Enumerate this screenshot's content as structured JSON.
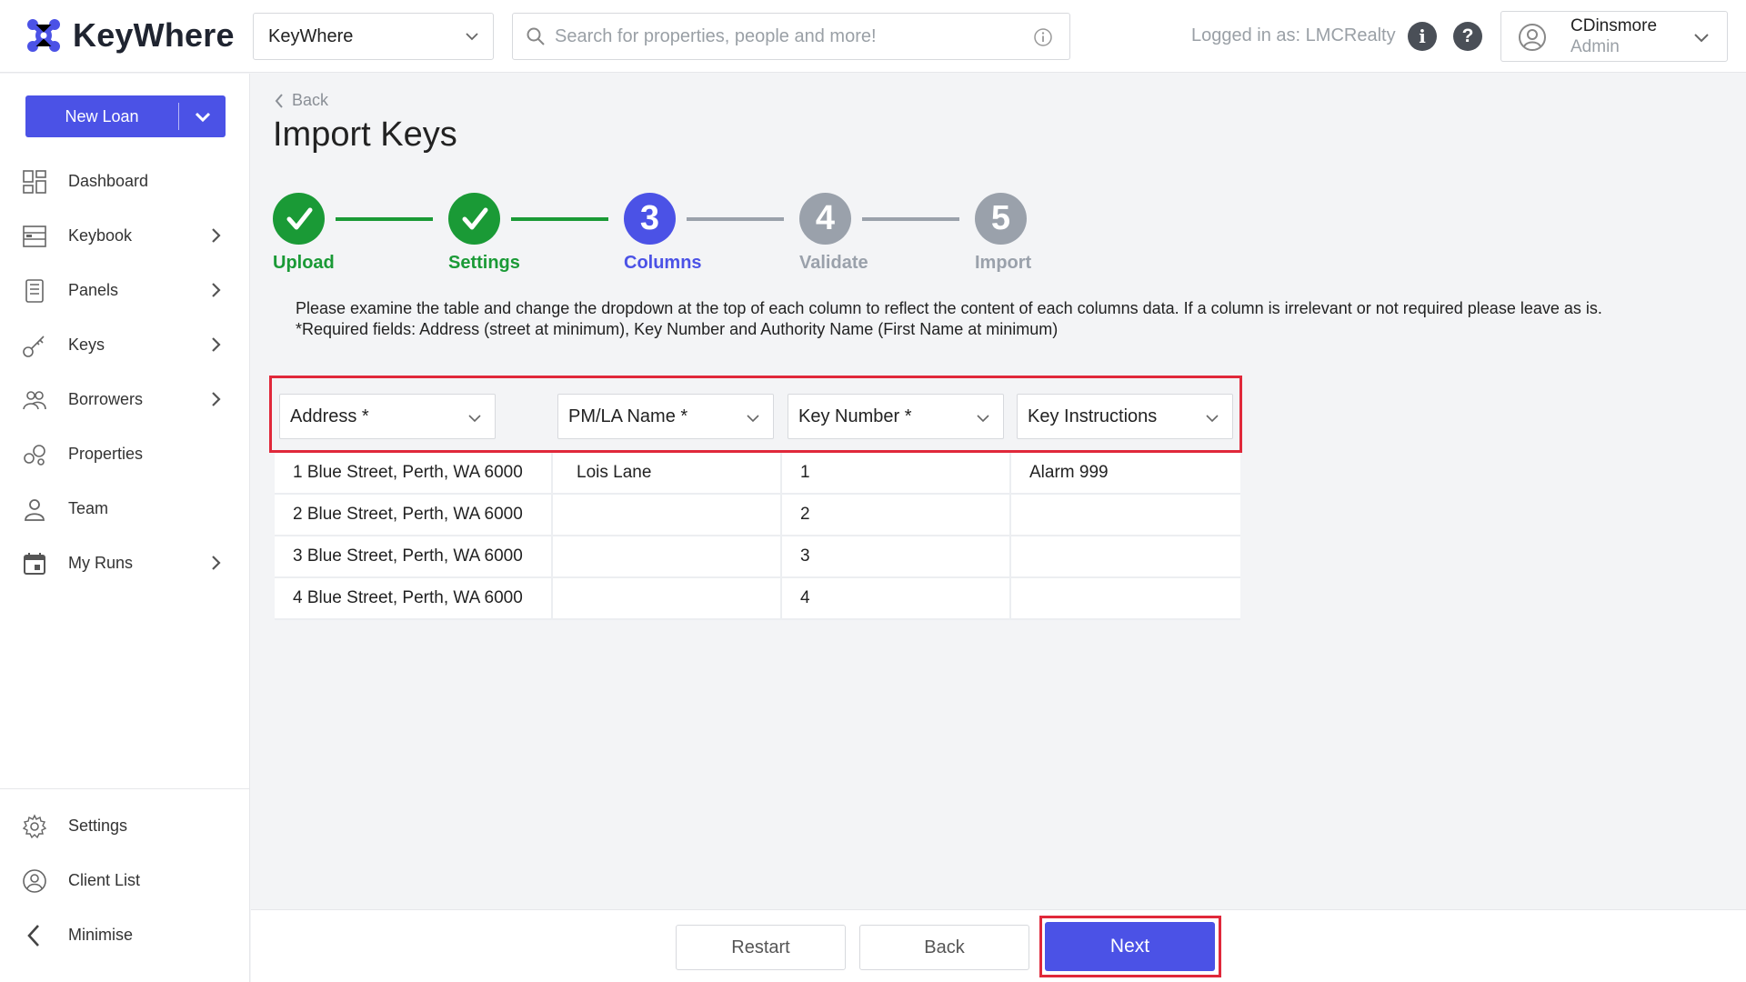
{
  "app": {
    "name": "KeyWhere"
  },
  "header": {
    "org_select": "KeyWhere",
    "search_placeholder": "Search for properties, people and more!",
    "logged_in_text": "Logged in as: LMCRealty",
    "user": {
      "name": "CDinsmore",
      "role": "Admin"
    }
  },
  "sidebar": {
    "new_loan_label": "New Loan",
    "items": [
      {
        "label": "Dashboard",
        "icon": "dashboard-icon",
        "has_submenu": false
      },
      {
        "label": "Keybook",
        "icon": "keybook-icon",
        "has_submenu": true
      },
      {
        "label": "Panels",
        "icon": "panels-icon",
        "has_submenu": true
      },
      {
        "label": "Keys",
        "icon": "keys-icon",
        "has_submenu": true
      },
      {
        "label": "Borrowers",
        "icon": "borrowers-icon",
        "has_submenu": true
      },
      {
        "label": "Properties",
        "icon": "properties-icon",
        "has_submenu": false
      },
      {
        "label": "Team",
        "icon": "team-icon",
        "has_submenu": false
      },
      {
        "label": "My Runs",
        "icon": "calendar-icon",
        "has_submenu": true
      }
    ],
    "bottom_items": [
      {
        "label": "Settings",
        "icon": "gear-icon"
      },
      {
        "label": "Client List",
        "icon": "client-list-icon"
      },
      {
        "label": "Minimise",
        "icon": "chevron-left-icon"
      }
    ]
  },
  "page": {
    "back_label": "Back",
    "title": "Import Keys",
    "steps": [
      {
        "number": "1",
        "label": "Upload",
        "state": "done"
      },
      {
        "number": "2",
        "label": "Settings",
        "state": "done"
      },
      {
        "number": "3",
        "label": "Columns",
        "state": "active"
      },
      {
        "number": "4",
        "label": "Validate",
        "state": "pending"
      },
      {
        "number": "5",
        "label": "Import",
        "state": "pending"
      }
    ],
    "instructions_line1": "Please examine the table and change the dropdown at the top of each column to reflect the content of each columns data. If a column is irrelevant or not required please leave as is.",
    "instructions_line2": "*Required fields: Address (street at minimum), Key Number and Authority Name (First Name at minimum)",
    "column_selects": [
      "Address *",
      "PM/LA Name *",
      "Key Number *",
      "Key Instructions"
    ],
    "rows": [
      [
        "1 Blue Street, Perth, WA 6000",
        "Lois Lane",
        "1",
        "Alarm 999"
      ],
      [
        "2 Blue Street, Perth, WA 6000",
        "",
        "2",
        ""
      ],
      [
        "3 Blue Street, Perth, WA 6000",
        "",
        "3",
        ""
      ],
      [
        "4 Blue Street, Perth, WA 6000",
        "",
        "4",
        ""
      ]
    ]
  },
  "footer": {
    "restart_label": "Restart",
    "back_label": "Back",
    "next_label": "Next"
  },
  "colors": {
    "accent": "#4b52e6",
    "success": "#1a9a36",
    "pending": "#9aa1ab",
    "highlight": "#e0283a"
  }
}
